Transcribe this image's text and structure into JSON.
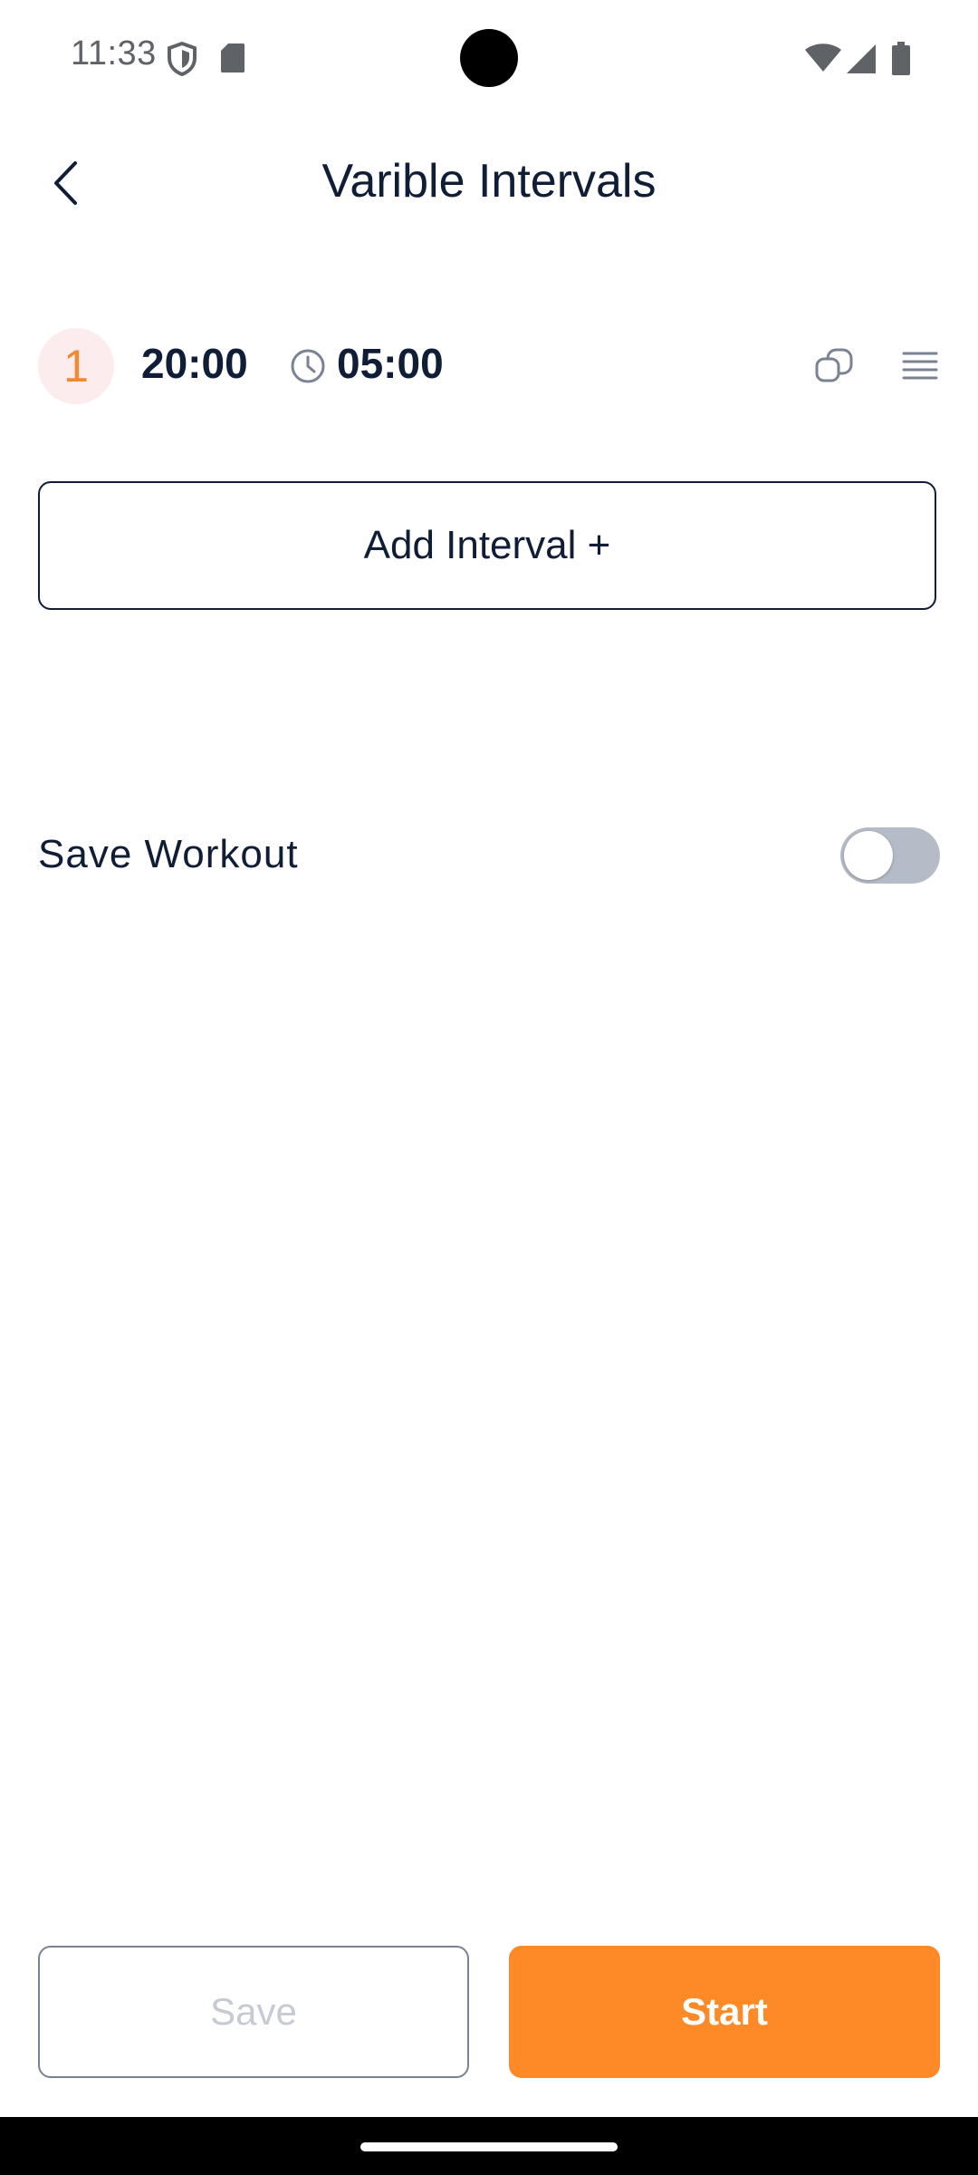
{
  "status_bar": {
    "time": "11:33",
    "icons": [
      "shield-icon",
      "sd-card-icon",
      "wifi-icon",
      "signal-icon",
      "battery-icon"
    ]
  },
  "header": {
    "title": "Varible Intervals",
    "back_icon": "chevron-left-icon"
  },
  "intervals": [
    {
      "index": "1",
      "duration": "20:00",
      "rest": "05:00"
    }
  ],
  "add_interval_label": "Add Interval +",
  "save_workout": {
    "label": "Save Workout",
    "enabled": false
  },
  "actions": {
    "save_label": "Save",
    "start_label": "Start"
  },
  "colors": {
    "accent": "#fd8a27",
    "text": "#0f1e36",
    "badge_bg": "#fdecee",
    "toggle_off": "#b5bcc7"
  }
}
